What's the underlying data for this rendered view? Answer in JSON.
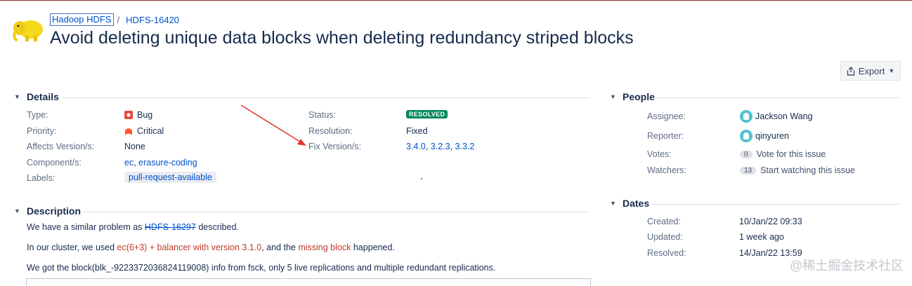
{
  "breadcrumb": {
    "project": "Hadoop HDFS",
    "separator": "/",
    "issue_key": "HDFS-16420"
  },
  "title": "Avoid deleting unique data blocks when deleting redundancy striped blocks",
  "toolbar": {
    "export_label": "Export"
  },
  "details": {
    "heading": "Details",
    "type": {
      "label": "Type:",
      "value": "Bug"
    },
    "priority": {
      "label": "Priority:",
      "value": "Critical"
    },
    "affects": {
      "label": "Affects Version/s:",
      "value": "None"
    },
    "components": {
      "label": "Component/s:",
      "items": [
        "ec",
        "erasure-coding"
      ],
      "separator": ", "
    },
    "labels": {
      "label": "Labels:",
      "value": "pull-request-available"
    },
    "status": {
      "label": "Status:",
      "value": "RESOLVED",
      "color": "#00875a"
    },
    "resolution": {
      "label": "Resolution:",
      "value": "Fixed"
    },
    "fix_versions": {
      "label": "Fix Version/s:",
      "items": [
        "3.4.0",
        "3.2.3",
        "3.3.2"
      ],
      "separator": ", "
    }
  },
  "description": {
    "heading": "Description",
    "p1": {
      "before": "We have a similar problem as ",
      "link": "HDFS-16297",
      "after": " described."
    },
    "p2": {
      "before": "In our cluster, we used ",
      "red1": "ec(6+3) + balancer with version 3.1.0",
      "mid": ", and the ",
      "red2": "missing block",
      "after": " happened."
    },
    "p3": "We got the block(blk_-9223372036824119008) info from fsck, only 5 live replications and multiple redundant replications."
  },
  "people": {
    "heading": "People",
    "assignee": {
      "label": "Assignee:",
      "value": "Jackson Wang"
    },
    "reporter": {
      "label": "Reporter:",
      "value": "qinyuren"
    },
    "votes": {
      "label": "Votes:",
      "count": "0",
      "action": "Vote for this issue"
    },
    "watchers": {
      "label": "Watchers:",
      "count": "13",
      "action": "Start watching this issue"
    }
  },
  "dates": {
    "heading": "Dates",
    "created": {
      "label": "Created:",
      "value": "10/Jan/22 09:33"
    },
    "updated": {
      "label": "Updated:",
      "value": "1 week ago"
    },
    "resolved": {
      "label": "Resolved:",
      "value": "14/Jan/22 13:59"
    }
  },
  "watermark": "@稀土掘金技术社区",
  "colors": {
    "accent": "#0052cc",
    "resolved": "#00875a",
    "annotation": "#e53935",
    "bug": "#e5493a",
    "priority": "#ff5630"
  },
  "icons": [
    "hadoop-elephant-logo",
    "bug-icon",
    "critical-priority-icon",
    "share-icon",
    "chevron-down-icon",
    "user-avatar-icon"
  ]
}
